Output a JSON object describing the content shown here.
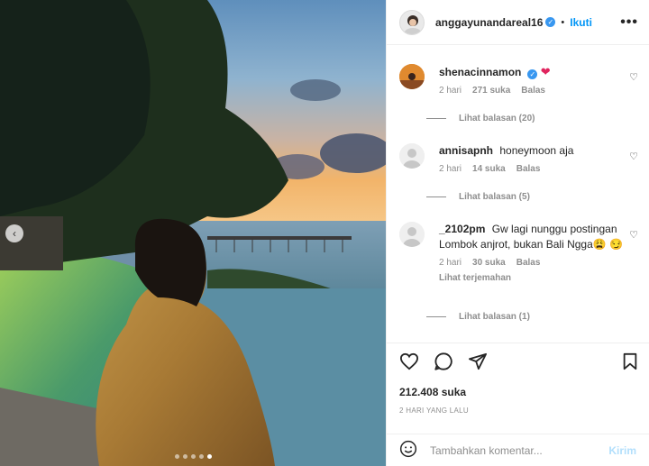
{
  "post": {
    "username": "anggayunandareal16",
    "follow_label": "Ikuti",
    "more_label": "•••",
    "separator": "•",
    "image_alt_icon": "chevron-left-icon",
    "carousel_count": 5,
    "carousel_active": 5
  },
  "comments": [
    {
      "user": "shenacinnamon",
      "verified": true,
      "text": "",
      "emoji": "❤",
      "time": "2 hari",
      "likes": "271 suka",
      "reply": "Balas",
      "view_replies": "Lihat balasan (20)"
    },
    {
      "user": "annisapnh",
      "verified": false,
      "text": "honeymoon aja",
      "time": "2 hari",
      "likes": "14 suka",
      "reply": "Balas",
      "view_replies": "Lihat balasan (5)"
    },
    {
      "user": "_2102pm",
      "verified": false,
      "text": "Gw lagi nunggu postingan Lombok anjrot, bukan Bali Ngga😩 😏",
      "time": "2 hari",
      "likes": "30 suka",
      "reply": "Balas",
      "translate": "Lihat terjemahan",
      "view_replies": "Lihat balasan (1)"
    }
  ],
  "stats": {
    "likes": "212.408 suka",
    "date": "2 HARI YANG LALU"
  },
  "composer": {
    "placeholder": "Tambahkan komentar...",
    "post_label": "Kirim"
  },
  "colors": {
    "accent": "#0095f6",
    "verified": "#3897f0",
    "muted": "#8e8e8e"
  }
}
